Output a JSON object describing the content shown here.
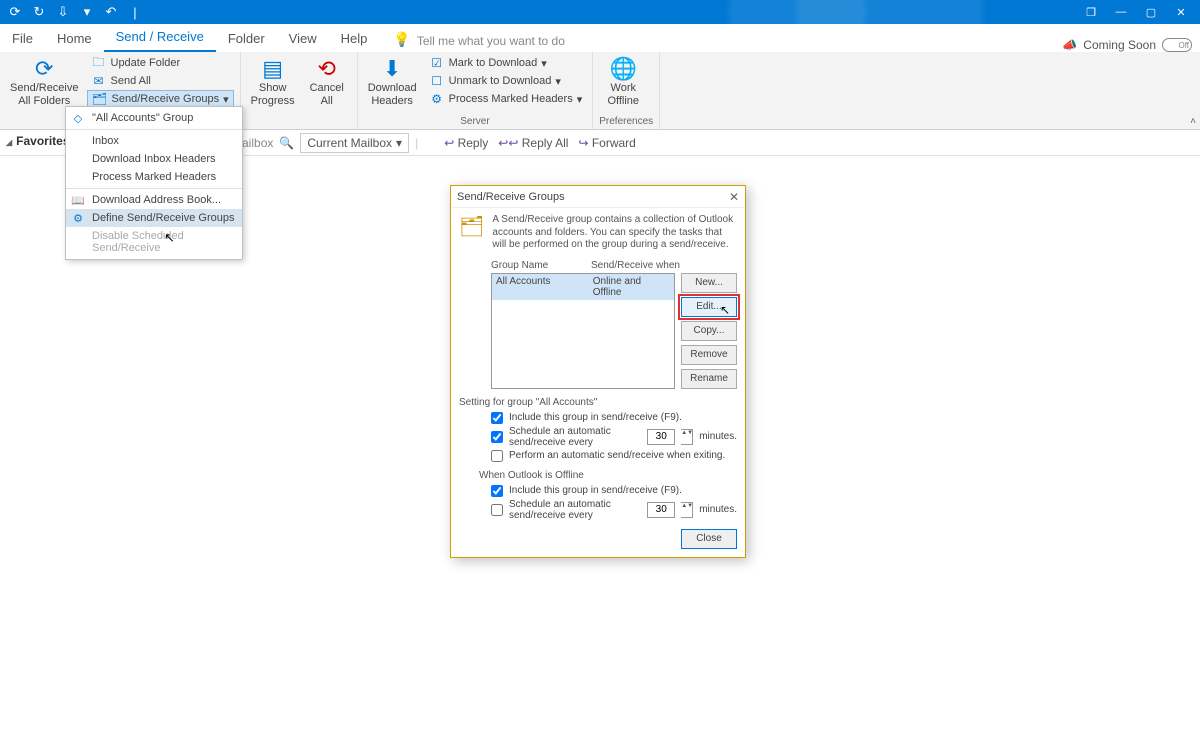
{
  "titlebar": {
    "qat_icons": [
      "sync",
      "redo",
      "attach",
      "chevron",
      "undo",
      "divider"
    ]
  },
  "window": {
    "restore": "❐",
    "min": "—",
    "close": "✕",
    "popout": "❐"
  },
  "tabs": {
    "items": [
      "File",
      "Home",
      "Send / Receive",
      "Folder",
      "View",
      "Help"
    ],
    "active_index": 2,
    "tellme": "Tell me what you want to do",
    "coming": "Coming Soon",
    "toggle": "Off"
  },
  "ribbon": {
    "sr_all": "Send/Receive\nAll Folders",
    "update_folder": "Update Folder",
    "send_all": "Send All",
    "sr_groups": "Send/Receive Groups",
    "show_progress": "Show\nProgress",
    "cancel_all": "Cancel\nAll",
    "download_headers": "Download\nHeaders",
    "mark_download": "Mark to Download",
    "unmark_download": "Unmark to Download",
    "process_marked": "Process Marked Headers",
    "server_label": "Server",
    "work_offline": "Work\nOffline",
    "preferences_label": "Preferences"
  },
  "toolbar": {
    "search_scope": "rent Mailbox",
    "scope_btn": "Current Mailbox",
    "reply": "Reply",
    "reply_all": "Reply All",
    "forward": "Forward"
  },
  "leftnav": {
    "favorites": "Favorites"
  },
  "menu": {
    "all_accounts_group": "\"All Accounts\" Group",
    "inbox": "Inbox",
    "dl_inbox": "Download Inbox Headers",
    "process_marked": "Process Marked Headers",
    "dl_addr": "Download Address Book...",
    "define_groups": "Define Send/Receive Groups",
    "disable_sched": "Disable Scheduled Send/Receive"
  },
  "dialog": {
    "title": "Send/Receive Groups",
    "desc": "A Send/Receive group contains a collection of Outlook accounts and folders. You can specify the tasks that will be performed on the group during a send/receive.",
    "col_group": "Group Name",
    "col_when": "Send/Receive when",
    "row_name": "All Accounts",
    "row_when": "Online and Offline",
    "btn_new": "New...",
    "btn_edit": "Edit...",
    "btn_copy": "Copy...",
    "btn_remove": "Remove",
    "btn_rename": "Rename",
    "settings_for": "Setting for group \"All Accounts\"",
    "include_f9": "Include this group in send/receive (F9).",
    "schedule_every": "Schedule an automatic send/receive every",
    "minutes": "minutes.",
    "perform_exit": "Perform an automatic send/receive when exiting.",
    "offline_heading": "When Outlook is Offline",
    "spin_online": "30",
    "spin_offline": "30",
    "close": "Close",
    "checks": {
      "online_include": true,
      "online_sched": true,
      "online_exit": false,
      "offline_include": true,
      "offline_sched": false
    }
  }
}
